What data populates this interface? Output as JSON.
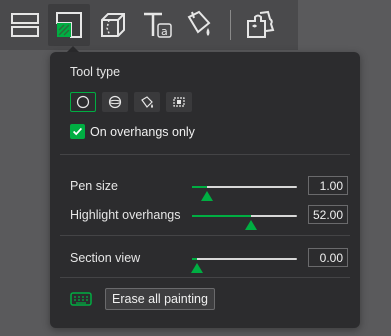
{
  "toolbar": {
    "tools": [
      {
        "icon": "layers-split-icon",
        "active": false
      },
      {
        "icon": "corner-support-icon",
        "active": true
      },
      {
        "icon": "cut-cube-icon",
        "active": false
      },
      {
        "icon": "text-tool-icon",
        "active": false
      },
      {
        "icon": "paint-bucket-icon",
        "active": false
      },
      {
        "icon": "assembly-icon",
        "active": false
      }
    ]
  },
  "panel": {
    "tool_type_title": "Tool type",
    "tool_types": [
      {
        "icon": "circle-brush-icon",
        "selected": true
      },
      {
        "icon": "sphere-brush-icon",
        "selected": false
      },
      {
        "icon": "fill-bucket-icon",
        "selected": false
      },
      {
        "icon": "gap-fill-icon",
        "selected": false
      }
    ],
    "overhang_only_label": "On overhangs only",
    "overhang_only_checked": true,
    "pen_size_label": "Pen size",
    "pen_size_value": "1.00",
    "pen_size_fraction": 0.14,
    "highlight_label": "Highlight overhangs",
    "highlight_value": "52.00",
    "highlight_fraction": 0.56,
    "section_label": "Section view",
    "section_value": "0.00",
    "section_fraction": 0.05,
    "erase_label": "Erase all painting"
  },
  "colors": {
    "accent": "#00ae42",
    "panel_bg": "#2c2c2e",
    "toolbar_bg": "#4a4a4c"
  }
}
